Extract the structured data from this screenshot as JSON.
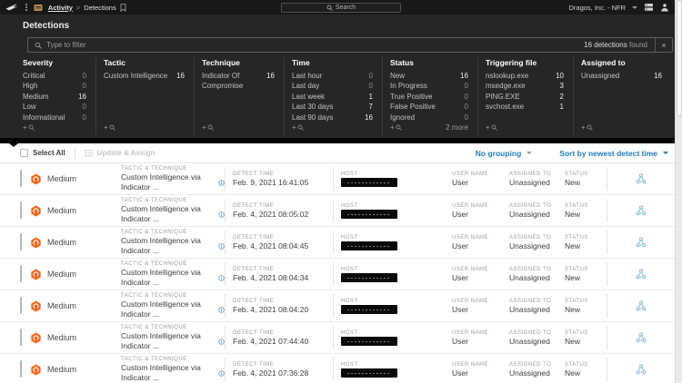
{
  "topbar": {
    "breadcrumb": {
      "activity": "Activity",
      "separator": ">",
      "current": "Detections"
    },
    "search_placeholder": "Search",
    "org": "Dragos, Inc. - NFR"
  },
  "page": {
    "title": "Detections"
  },
  "filter_bar": {
    "placeholder": "Type to filter",
    "result_count": "16 detections",
    "result_suffix": "found",
    "clear": "×"
  },
  "facets": [
    {
      "title": "Severity",
      "footer_add": "+",
      "items": [
        {
          "label": "Critical",
          "count": "0"
        },
        {
          "label": "High",
          "count": "0"
        },
        {
          "label": "Medium",
          "count": "16"
        },
        {
          "label": "Low",
          "count": "0"
        },
        {
          "label": "Informational",
          "count": "0"
        }
      ]
    },
    {
      "title": "Tactic",
      "footer_add": "+",
      "items": [
        {
          "label": "Custom Intelligence",
          "count": "16"
        }
      ]
    },
    {
      "title": "Technique",
      "footer_add": "+",
      "items": [
        {
          "label": "Indicator Of Compromise",
          "count": "16"
        }
      ]
    },
    {
      "title": "Time",
      "footer_add": "+",
      "items": [
        {
          "label": "Last hour",
          "count": "0"
        },
        {
          "label": "Last day",
          "count": "0"
        },
        {
          "label": "Last week",
          "count": "1"
        },
        {
          "label": "Last 30 days",
          "count": "7"
        },
        {
          "label": "Last 90 days",
          "count": "16"
        }
      ]
    },
    {
      "title": "Status",
      "footer_add": "+",
      "more": "2 more",
      "items": [
        {
          "label": "New",
          "count": "16"
        },
        {
          "label": "In Progress",
          "count": "0"
        },
        {
          "label": "True Positive",
          "count": "0"
        },
        {
          "label": "False Positive",
          "count": "0"
        },
        {
          "label": "Ignored",
          "count": "0"
        }
      ]
    },
    {
      "title": "Triggering file",
      "footer_add": "+",
      "items": [
        {
          "label": "nslookup.exe",
          "count": "10"
        },
        {
          "label": "msedge.exe",
          "count": "3"
        },
        {
          "label": "PING.EXE",
          "count": "2"
        },
        {
          "label": "svchost.exe",
          "count": "1"
        }
      ]
    },
    {
      "title": "Assigned to",
      "footer_add": "+",
      "items": [
        {
          "label": "Unassigned",
          "count": "16"
        }
      ]
    }
  ],
  "toolbar": {
    "select_all": "Select All",
    "update_assign": "Update & Assign",
    "grouping": "No grouping",
    "sort": "Sort by newest detect time"
  },
  "table": {
    "columns": {
      "tactic": "TACTIC & TECHNIQUE",
      "detect": "DETECT TIME",
      "host": "HOST",
      "user": "USER NAME",
      "assigned": "ASSIGNED TO",
      "status": "STATUS"
    },
    "rows": [
      {
        "severity": "Medium",
        "tactic": "Custom Intelligence via Indicator ...",
        "detect_time": "Feb. 9, 2021 16:41:05",
        "host_redacted": true,
        "user": "User",
        "assigned": "Unassigned",
        "status": "New"
      },
      {
        "severity": "Medium",
        "tactic": "Custom Intelligence via Indicator ...",
        "detect_time": "Feb. 4, 2021 08:05:02",
        "host_redacted": true,
        "user": "User",
        "assigned": "Unassigned",
        "status": "New"
      },
      {
        "severity": "Medium",
        "tactic": "Custom Intelligence via Indicator ...",
        "detect_time": "Feb. 4, 2021 08:04:45",
        "host_redacted": true,
        "user": "User",
        "assigned": "Unassigned",
        "status": "New"
      },
      {
        "severity": "Medium",
        "tactic": "Custom Intelligence via Indicator ...",
        "detect_time": "Feb. 4, 2021 08:04:34",
        "host_redacted": true,
        "user": "User",
        "assigned": "Unassigned",
        "status": "New"
      },
      {
        "severity": "Medium",
        "tactic": "Custom Intelligence via Indicator ...",
        "detect_time": "Feb. 4, 2021 08:04:20",
        "host_redacted": true,
        "user": "User",
        "assigned": "Unassigned",
        "status": "New"
      },
      {
        "severity": "Medium",
        "tactic": "Custom Intelligence via Indicator ...",
        "detect_time": "Feb. 4, 2021 07:44:40",
        "host_redacted": true,
        "user": "User",
        "assigned": "Unassigned",
        "status": "New"
      },
      {
        "severity": "Medium",
        "tactic": "Custom Intelligence via Indicator ...",
        "detect_time": "Feb. 4, 2021 07:36:28",
        "host_redacted": true,
        "user": "User",
        "assigned": "Unassigned",
        "status": "New"
      }
    ]
  },
  "colors": {
    "accent_blue": "#1f7bbf",
    "severity_medium_orange": "#f0681e",
    "action_icon_blue": "#7fb9d8",
    "topbar_bg": "#181818",
    "panel_bg": "#262626"
  }
}
